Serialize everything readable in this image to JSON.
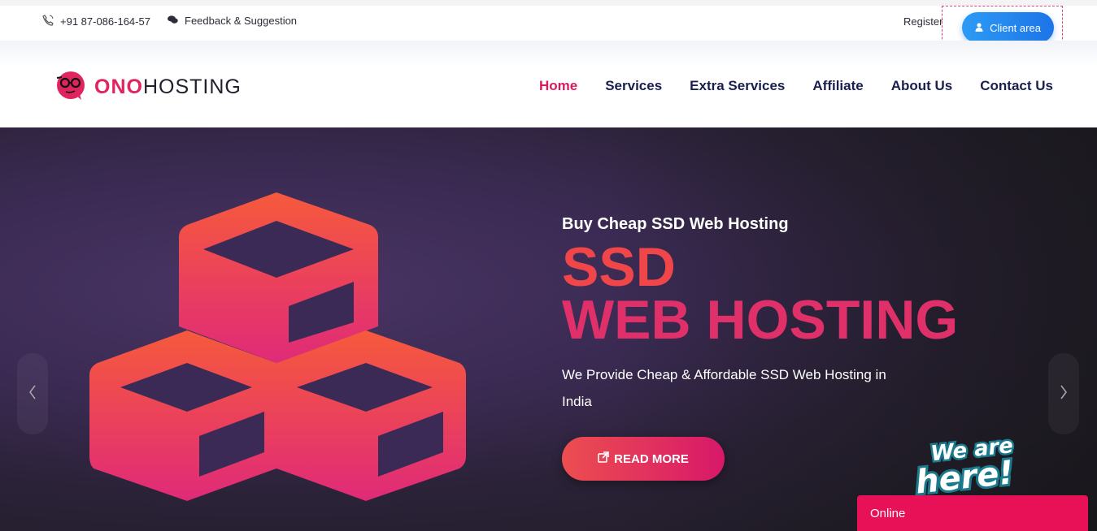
{
  "topbar": {
    "phone": "+91 87-086-164-57",
    "feedback": "Feedback & Suggestion",
    "register": "Register",
    "client_area": "Client area"
  },
  "header": {
    "logo_ono": "ONO",
    "logo_hosting": "HOSTING",
    "nav": [
      "Home",
      "Services",
      "Extra Services",
      "Affiliate",
      "About Us",
      "Contact Us"
    ],
    "active_nav": "Home"
  },
  "hero": {
    "eyebrow": "Buy Cheap SSD Web Hosting",
    "title_line1": "SSD",
    "title_line2": "WEB HOSTING",
    "description": "We Provide Cheap & Affordable SSD Web Hosting in India",
    "read_more": "READ MORE",
    "prev_icon": "chevron-left-icon",
    "next_icon": "chevron-right-icon"
  },
  "chat": {
    "badge_line1": "We are",
    "badge_line2": "here!",
    "status": "Online"
  },
  "colors": {
    "accent": "#e0245e",
    "nav_text": "#1a1f4e",
    "client_button": "#2c9bf5",
    "chat_bar": "#e81158"
  }
}
